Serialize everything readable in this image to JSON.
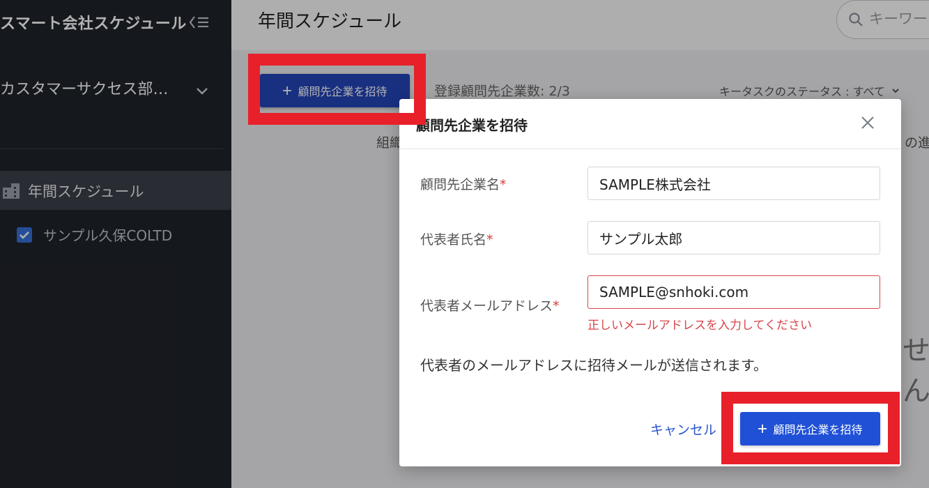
{
  "sidebar": {
    "brand": "スマート会社スケジュール",
    "department": "カスタマーサクセス部…",
    "nav_item": "年間スケジュール",
    "sub_item": "サンプル久保COLTD"
  },
  "header": {
    "title": "年間スケジュール",
    "search_placeholder": "キーワー"
  },
  "toolbar": {
    "invite_label": "顧問先企業を招待",
    "count_label": "登録顧問先企業数: 2/3",
    "status_filter": "キータスクのステータス : すべて"
  },
  "table": {
    "col_left": "組織",
    "col_right": "の進捗"
  },
  "empty_text": "せん",
  "modal": {
    "title": "顧問先企業を招待",
    "company_label": "顧問先企業名",
    "company_value": "SAMPLE株式会社",
    "rep_label": "代表者氏名",
    "rep_value": "サンプル太郎",
    "email_label": "代表者メールアドレス",
    "email_value": "SAMPLE@snhoki.com",
    "email_error": "正しいメールアドレスを入力してください",
    "note": "代表者のメールアドレスに招待メールが送信されます。",
    "cancel_label": "キャンセル",
    "submit_label": "顧問先企業を招待",
    "required_mark": "*"
  },
  "colors": {
    "sidebar_bg": "#1f232a",
    "primary": "#1f50d6",
    "error": "#d9444a",
    "highlight": "#e8202a"
  }
}
